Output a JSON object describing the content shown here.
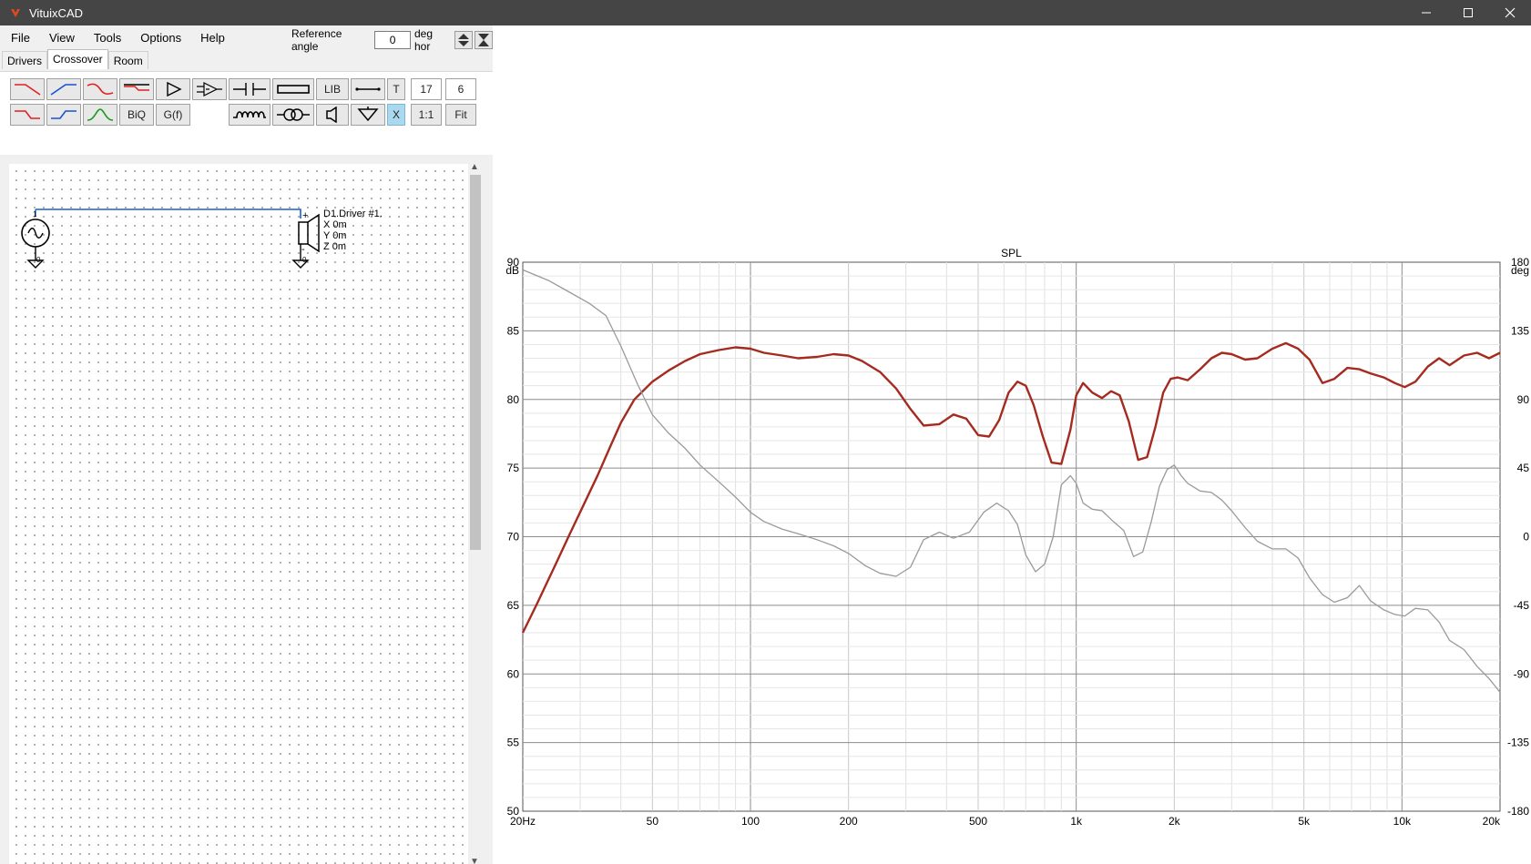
{
  "window": {
    "title": "VituixCAD"
  },
  "menu": [
    "File",
    "View",
    "Tools",
    "Options",
    "Help"
  ],
  "reference": {
    "label": "Reference angle",
    "value": "0",
    "unit": "deg hor"
  },
  "tabs": [
    "Drivers",
    "Crossover",
    "Room"
  ],
  "toolbar": {
    "lib": "LIB",
    "t": "T",
    "val17": "17",
    "val6": "6",
    "biq": "BiQ",
    "gf": "G(f)",
    "x": "X",
    "one_to_one": "1:1",
    "fit": "Fit"
  },
  "schematic": {
    "driver_name": "D1.Driver #1.",
    "x": "X 0m",
    "y": "Y 0m",
    "z": "Z 0m",
    "plus": "+",
    "minus": "-",
    "node_a": "1",
    "node_b": "0",
    "node_c": "0"
  },
  "colors": {
    "spl": "#a52a1f",
    "phase": "#9a9a9a",
    "wire": "#1a5fc8",
    "red": "#e02020",
    "blue": "#1a50d0",
    "green": "#1a9a1a"
  },
  "chart_data": {
    "type": "line",
    "title": "SPL",
    "ylabel": "dB",
    "y2label": "deg",
    "x_scale": "log",
    "xlim": [
      20,
      20000
    ],
    "ylim": [
      50,
      90
    ],
    "y2lim": [
      -180,
      180
    ],
    "x_ticks": [
      "20Hz",
      "50",
      "100",
      "200",
      "500",
      "1k",
      "2k",
      "5k",
      "10k",
      "20k"
    ],
    "x_tick_values": [
      20,
      50,
      100,
      200,
      500,
      1000,
      2000,
      5000,
      10000,
      20000
    ],
    "y_ticks": [
      90,
      85,
      80,
      75,
      70,
      65,
      60,
      55,
      50
    ],
    "y2_ticks": [
      180,
      135,
      90,
      45,
      0,
      -45,
      -90,
      -135,
      -180
    ],
    "grid": true,
    "series": [
      {
        "axis": "left",
        "x": [
          20,
          22,
          25,
          28,
          31,
          34,
          37,
          40,
          44,
          50,
          56,
          63,
          70,
          80,
          90,
          100,
          110,
          125,
          140,
          160,
          180,
          200,
          220,
          250,
          280,
          310,
          340,
          380,
          420,
          460,
          500,
          540,
          580,
          620,
          660,
          700,
          740,
          790,
          840,
          900,
          960,
          1000,
          1050,
          1120,
          1200,
          1280,
          1360,
          1450,
          1550,
          1650,
          1750,
          1850,
          1950,
          2050,
          2200,
          2400,
          2600,
          2800,
          3000,
          3300,
          3600,
          4000,
          4400,
          4800,
          5200,
          5700,
          6200,
          6800,
          7400,
          8000,
          8800,
          9500,
          10200,
          11000,
          12000,
          13000,
          14000,
          15500,
          17000,
          18500,
          20000
        ],
        "y": [
          63.0,
          65.0,
          67.8,
          70.3,
          72.5,
          74.5,
          76.5,
          78.3,
          80.0,
          81.3,
          82.1,
          82.8,
          83.3,
          83.6,
          83.8,
          83.7,
          83.4,
          83.2,
          83.0,
          83.1,
          83.3,
          83.2,
          82.8,
          82.0,
          80.8,
          79.3,
          78.1,
          78.2,
          78.9,
          78.6,
          77.4,
          77.3,
          78.5,
          80.5,
          81.3,
          81.0,
          79.6,
          77.3,
          75.4,
          75.3,
          77.8,
          80.3,
          81.2,
          80.5,
          80.1,
          80.6,
          80.3,
          78.4,
          75.6,
          75.8,
          78.0,
          80.5,
          81.5,
          81.6,
          81.4,
          82.2,
          83.0,
          83.4,
          83.3,
          82.9,
          83.0,
          83.7,
          84.1,
          83.7,
          82.9,
          81.2,
          81.5,
          82.3,
          82.2,
          81.9,
          81.6,
          81.2,
          80.9,
          81.3,
          82.4,
          83.0,
          82.5,
          83.2,
          83.4,
          83.0,
          83.4
        ]
      },
      {
        "axis": "right",
        "x": [
          20,
          24,
          28,
          32,
          36,
          40,
          45,
          50,
          56,
          63,
          70,
          80,
          90,
          100,
          110,
          125,
          140,
          160,
          180,
          200,
          225,
          250,
          280,
          310,
          340,
          380,
          420,
          470,
          520,
          570,
          620,
          660,
          700,
          750,
          800,
          850,
          900,
          960,
          1000,
          1050,
          1120,
          1200,
          1300,
          1400,
          1500,
          1600,
          1700,
          1800,
          1900,
          2000,
          2100,
          2200,
          2400,
          2600,
          2800,
          3000,
          3300,
          3600,
          4000,
          4400,
          4800,
          5200,
          5700,
          6200,
          6800,
          7400,
          8000,
          8800,
          9500,
          10200,
          11000,
          12000,
          13000,
          14000,
          15500,
          17000,
          18500,
          20000
        ],
        "y": [
          175,
          168,
          160,
          153,
          145,
          125,
          100,
          80,
          68,
          58,
          47,
          36,
          26,
          16,
          10,
          5,
          2,
          -2,
          -6,
          -11,
          -19,
          -24,
          -26,
          -20,
          -2,
          3,
          -1,
          3,
          16,
          22,
          17,
          8,
          -12,
          -23,
          -18,
          0,
          34,
          40,
          35,
          22,
          18,
          17,
          10,
          4,
          -13,
          -10,
          10,
          33,
          44,
          47,
          40,
          35,
          30,
          29,
          24,
          17,
          6,
          -3,
          -8,
          -8,
          -14,
          -27,
          -38,
          -43,
          -40,
          -32,
          -42,
          -48,
          -51,
          -52,
          -47,
          -48,
          -56,
          -68,
          -74,
          -85,
          -93,
          -102
        ]
      }
    ]
  }
}
